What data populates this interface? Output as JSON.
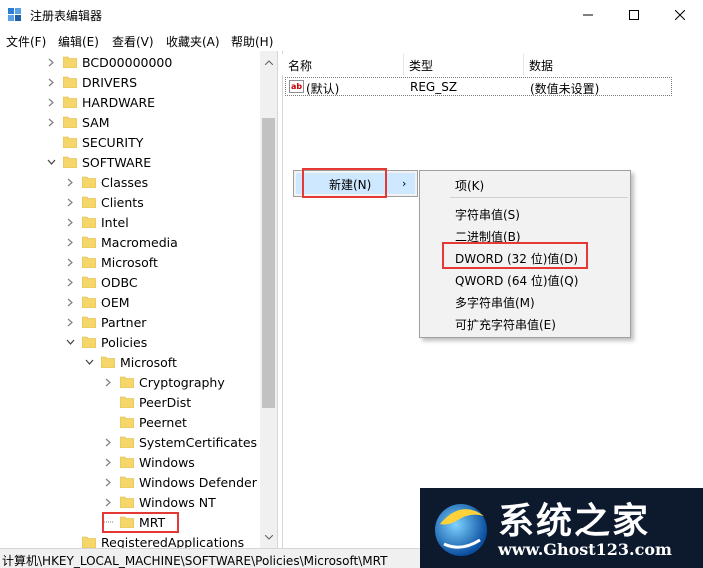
{
  "window": {
    "title": "注册表编辑器",
    "icon": "regedit-icon"
  },
  "menubar": [
    {
      "label": "文件(F)"
    },
    {
      "label": "编辑(E)"
    },
    {
      "label": "查看(V)"
    },
    {
      "label": "收藏夹(A)"
    },
    {
      "label": "帮助(H)"
    }
  ],
  "tree": [
    {
      "label": "BCD00000000",
      "arrow": "collapsed"
    },
    {
      "label": "DRIVERS",
      "arrow": "collapsed"
    },
    {
      "label": "HARDWARE",
      "arrow": "collapsed"
    },
    {
      "label": "SAM",
      "arrow": "collapsed"
    },
    {
      "label": "SECURITY",
      "arrow": "none"
    },
    {
      "label": "SOFTWARE",
      "arrow": "expanded"
    },
    {
      "label": "Classes",
      "arrow": "collapsed"
    },
    {
      "label": "Clients",
      "arrow": "collapsed"
    },
    {
      "label": "Intel",
      "arrow": "collapsed"
    },
    {
      "label": "Macromedia",
      "arrow": "collapsed"
    },
    {
      "label": "Microsoft",
      "arrow": "collapsed"
    },
    {
      "label": "ODBC",
      "arrow": "collapsed"
    },
    {
      "label": "OEM",
      "arrow": "collapsed"
    },
    {
      "label": "Partner",
      "arrow": "collapsed"
    },
    {
      "label": "Policies",
      "arrow": "expanded"
    },
    {
      "label": "Microsoft",
      "arrow": "expanded"
    },
    {
      "label": "Cryptography",
      "arrow": "collapsed"
    },
    {
      "label": "PeerDist",
      "arrow": "none"
    },
    {
      "label": "Peernet",
      "arrow": "none"
    },
    {
      "label": "SystemCertificates",
      "arrow": "collapsed"
    },
    {
      "label": "Windows",
      "arrow": "collapsed"
    },
    {
      "label": "Windows Defender",
      "arrow": "collapsed"
    },
    {
      "label": "Windows NT",
      "arrow": "collapsed"
    },
    {
      "label": "MRT",
      "arrow": "none",
      "selected": true
    },
    {
      "label": "RegisteredApplications",
      "arrow": "none"
    }
  ],
  "list": {
    "columns": [
      "名称",
      "类型",
      "数据"
    ],
    "rows": [
      {
        "name": "(默认)",
        "type": "REG_SZ",
        "data": "(数值未设置)"
      }
    ]
  },
  "context_menu": {
    "new_label": "新建(N)",
    "submenu": [
      {
        "label": "项(K)"
      },
      {
        "label": "字符串值(S)"
      },
      {
        "label": "二进制值(B)"
      },
      {
        "label": "DWORD (32 位)值(D)"
      },
      {
        "label": "QWORD (64 位)值(Q)"
      },
      {
        "label": "多字符串值(M)"
      },
      {
        "label": "可扩充字符串值(E)"
      }
    ]
  },
  "statusbar": {
    "path": "计算机\\HKEY_LOCAL_MACHINE\\SOFTWARE\\Policies\\Microsoft\\MRT"
  },
  "watermark": {
    "title": "系统之家",
    "url": "www.Ghost123.com"
  },
  "colors": {
    "highlight_outline": "#e53935",
    "menu_hover": "#cde8ff",
    "folder": "#f5d66b"
  }
}
